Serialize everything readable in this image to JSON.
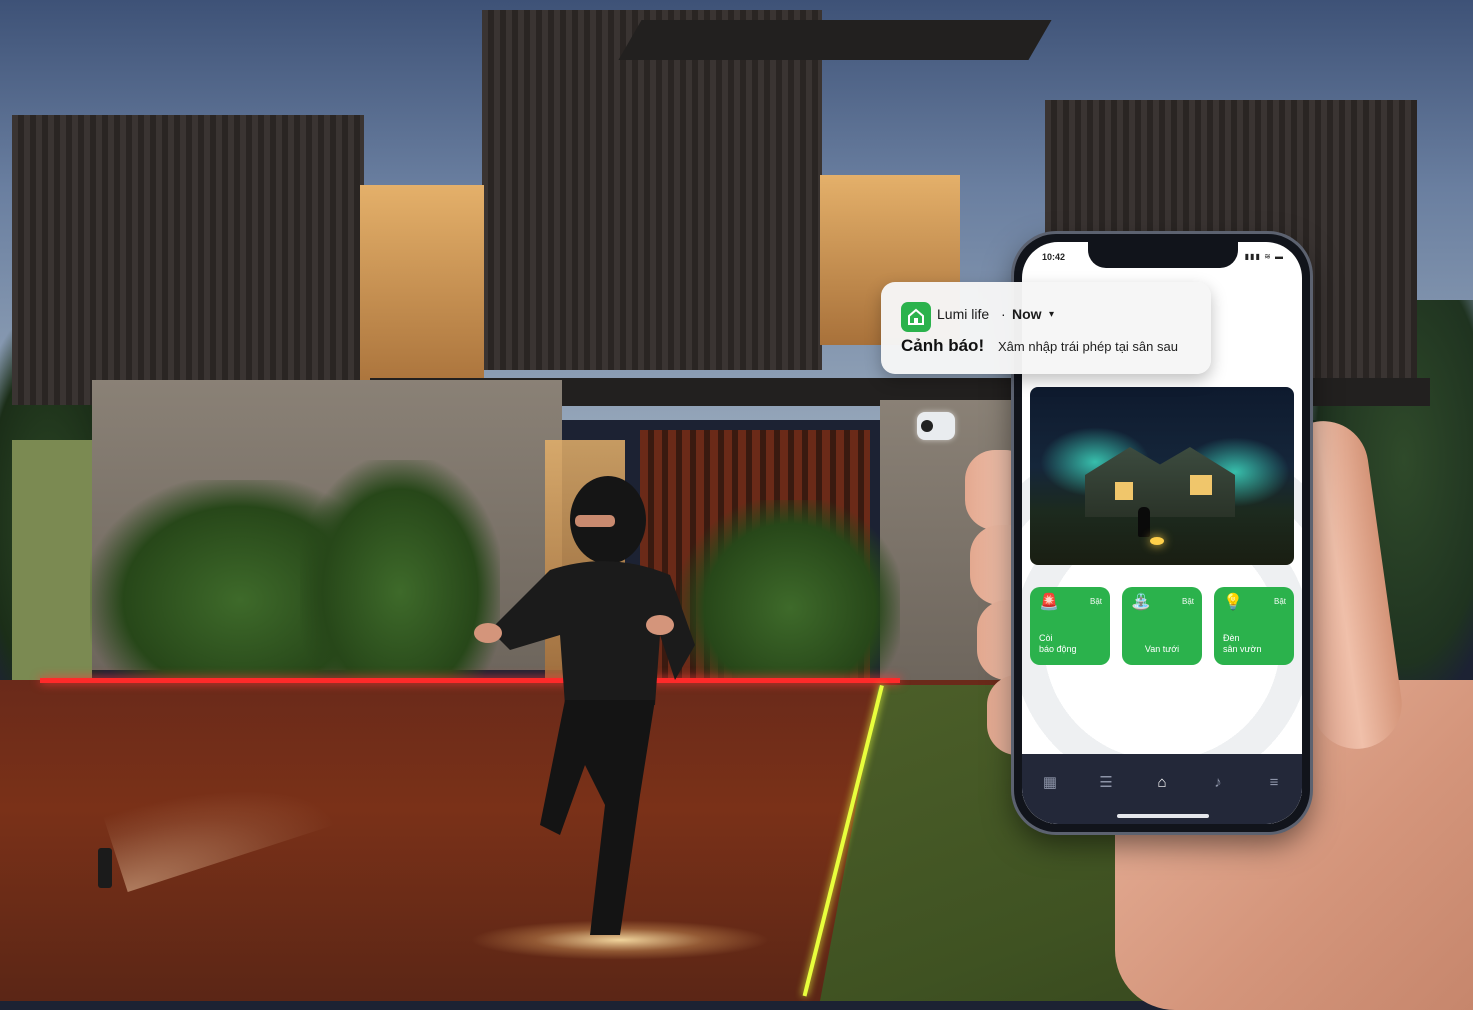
{
  "scene": {
    "description_icon": "house-security-scene"
  },
  "phone": {
    "status_time": "10:42",
    "status_icons": "▮▮▮ ≋ ▬",
    "notification": {
      "app_name": "Lumi life",
      "separator": "·",
      "time": "Now",
      "title": "Cảnh báo!",
      "body": "Xâm nhập trái phép tại sân sau"
    },
    "controls": [
      {
        "label": "Còi\nbáo động",
        "state": "Bật",
        "icon": "siren-icon"
      },
      {
        "label": "Van tưới",
        "state": "Bật",
        "icon": "sprinkler-icon"
      },
      {
        "label": "Đèn\nsân vườn",
        "state": "Bật",
        "icon": "garden-light-icon"
      }
    ],
    "nav": [
      {
        "name": "dashboard-icon",
        "active": false
      },
      {
        "name": "rooms-icon",
        "active": false
      },
      {
        "name": "home-icon",
        "active": true
      },
      {
        "name": "music-icon",
        "active": false
      },
      {
        "name": "menu-icon",
        "active": false
      }
    ]
  },
  "colors": {
    "accent": "#2bb24c",
    "nav_bg": "#232839",
    "laser": "#ff2a2a",
    "boundary": "#e8ff3c"
  }
}
